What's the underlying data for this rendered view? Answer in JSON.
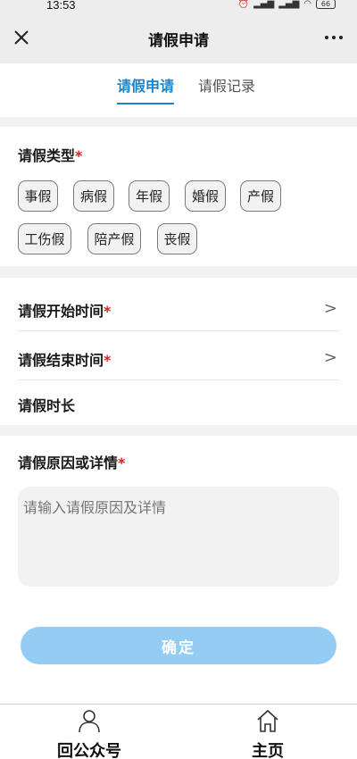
{
  "status": {
    "time": "13:53",
    "battery": "66"
  },
  "nav": {
    "title": "请假申请"
  },
  "tabs": [
    {
      "label": "请假申请",
      "active": true
    },
    {
      "label": "请假记录",
      "active": false
    }
  ],
  "leave_type": {
    "label": "请假类型",
    "required_mark": "*",
    "options": [
      "事假",
      "病假",
      "年假",
      "婚假",
      "产假",
      "工伤假",
      "陪产假",
      "丧假"
    ]
  },
  "time_fields": {
    "start_label": "请假开始时间",
    "end_label": "请假结束时间",
    "duration_label": "请假时长",
    "required_mark": "*",
    "chevron": ">"
  },
  "reason": {
    "label": "请假原因或详情",
    "required_mark": "*",
    "placeholder": "请输入请假原因及详情"
  },
  "confirm_label": "确定",
  "bottom_bar": {
    "official_account_label": "回公众号",
    "home_label": "主页"
  },
  "colors": {
    "accent": "#1f84c6",
    "required": "#d9201c",
    "confirm_bg": "#94cdf4"
  }
}
